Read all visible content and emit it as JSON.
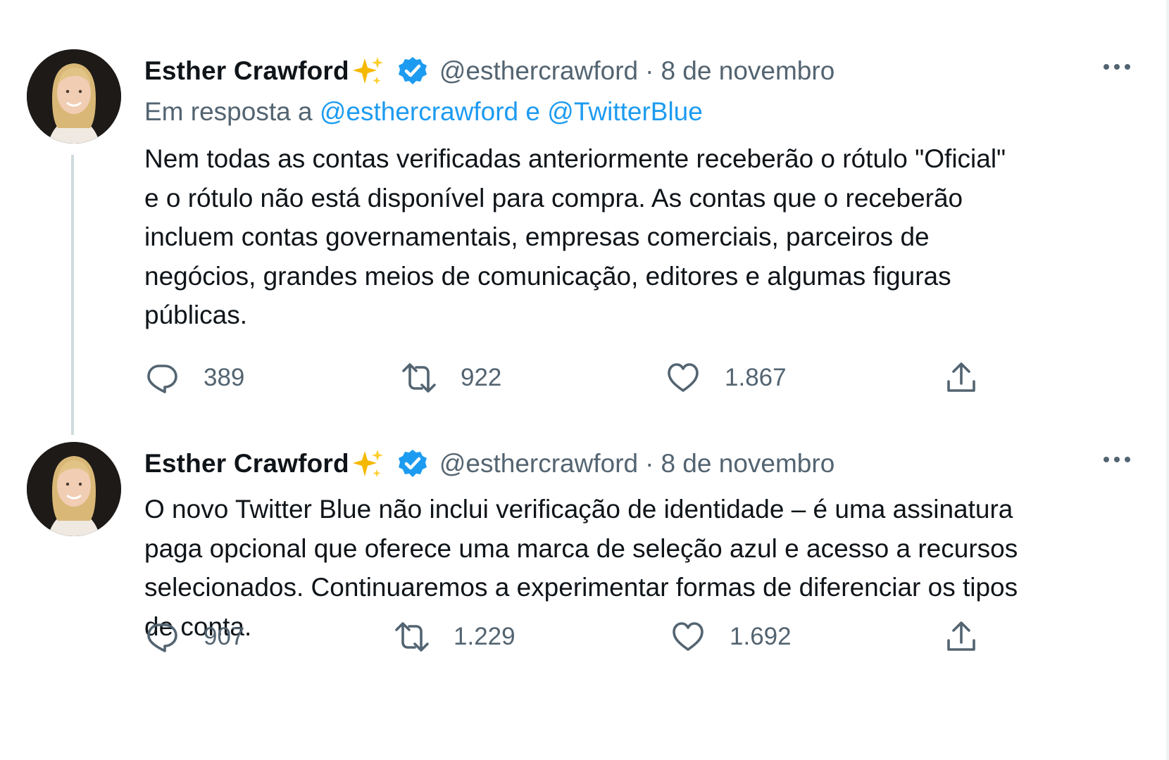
{
  "tweets": [
    {
      "author_name": "Esther Crawford",
      "handle": "@esthercrawford",
      "separator": "·",
      "date": "8 de novembro",
      "reply_to": {
        "prefix": "Em resposta a",
        "mention_1": "@esthercrawford",
        "conjunction": "e",
        "mention_2": "@TwitterBlue"
      },
      "text": "Nem todas as contas verificadas anteriormente receberão o rótulo \"Oficial\"\ne o rótulo não está disponível para compra. As contas que o receberão\nincluem contas governamentais, empresas comerciais, parceiros de\nnegócios, grandes meios de comunicação, editores e algumas figuras\npúblicas.",
      "replies": "389",
      "retweets": "922",
      "likes": "1.867"
    },
    {
      "author_name": "Esther Crawford",
      "handle": "@esthercrawford",
      "separator": "·",
      "date": "8 de novembro",
      "text": "O novo Twitter Blue não inclui verificação de identidade – é uma assinatura\npaga opcional que oferece uma marca de seleção azul e acesso a recursos\nselecionados. Continuaremos a experimentar formas de diferenciar os tipos\nde conta.",
      "replies": "907",
      "retweets": "1.229",
      "likes": "1.692"
    }
  ],
  "icons": {
    "sparkle": "sparkles-icon",
    "verified": "verified-badge-icon",
    "more": "more-options-icon",
    "reply": "reply-icon",
    "retweet": "retweet-icon",
    "like": "heart-icon",
    "share": "share-icon"
  },
  "colors": {
    "accent": "#1d9bf0",
    "secondary_text": "#536471",
    "primary_text": "#0f1419",
    "thread_line": "#cfd9de",
    "sparkle": "#f5b800"
  }
}
